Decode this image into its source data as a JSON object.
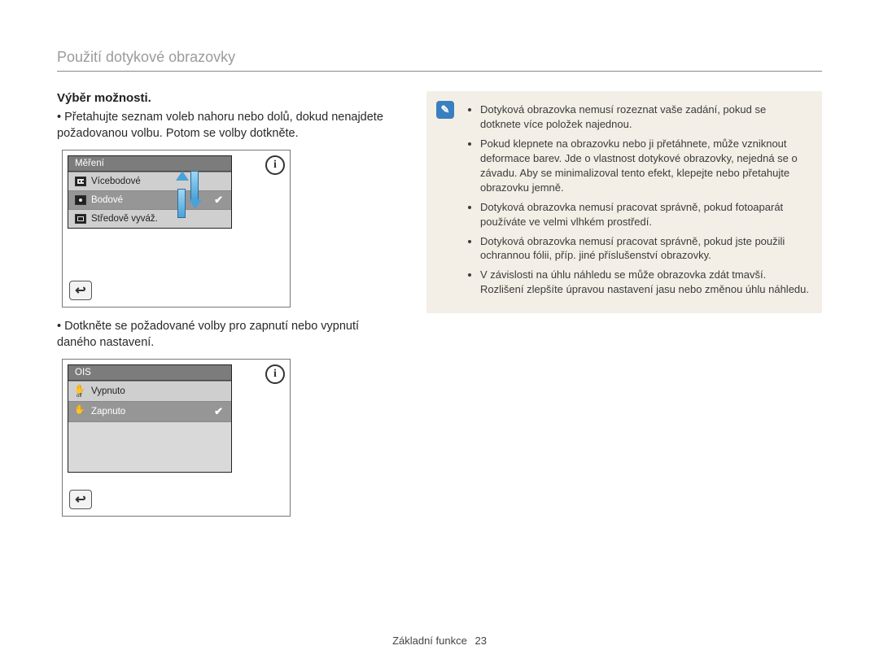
{
  "page": {
    "title": "Použití dotykové obrazovky",
    "footer_label": "Základní funkce",
    "footer_page": "23"
  },
  "left": {
    "heading": "Výběr možnosti.",
    "para1": "Přetahujte seznam voleb nahoru nebo dolů, dokud nenajdete požadovanou volbu. Potom se volby dotkněte.",
    "para2": "Dotkněte se požadované volby pro zapnutí nebo vypnutí daného nastavení.",
    "fig1": {
      "title": "Měření",
      "row1": "Vícebodové",
      "row2": "Bodové",
      "row3": "Středově vyváž.",
      "info_glyph": "i",
      "back_glyph": "↩"
    },
    "fig2": {
      "title": "OIS",
      "row1": "Vypnuto",
      "row2": "Zapnuto",
      "info_glyph": "i",
      "back_glyph": "↩"
    }
  },
  "notes": {
    "icon_glyph": "✎",
    "items": [
      "Dotyková obrazovka nemusí rozeznat vaše zadání, pokud se dotknete více položek najednou.",
      "Pokud klepnete na obrazovku nebo ji přetáhnete, může vzniknout deformace barev. Jde o vlastnost dotykové obrazovky, nejedná se o závadu. Aby se minimalizoval tento efekt, klepejte nebo přetahujte obrazovku jemně.",
      "Dotyková obrazovka nemusí pracovat správně, pokud fotoaparát používáte ve velmi vlhkém prostředí.",
      "Dotyková obrazovka nemusí pracovat správně, pokud jste použili ochrannou fólii, příp. jiné příslušenství obrazovky.",
      "V závislosti na úhlu náhledu se může obrazovka zdát tmavší. Rozlišení zlepšíte úpravou nastavení jasu nebo změnou úhlu náhledu."
    ]
  }
}
